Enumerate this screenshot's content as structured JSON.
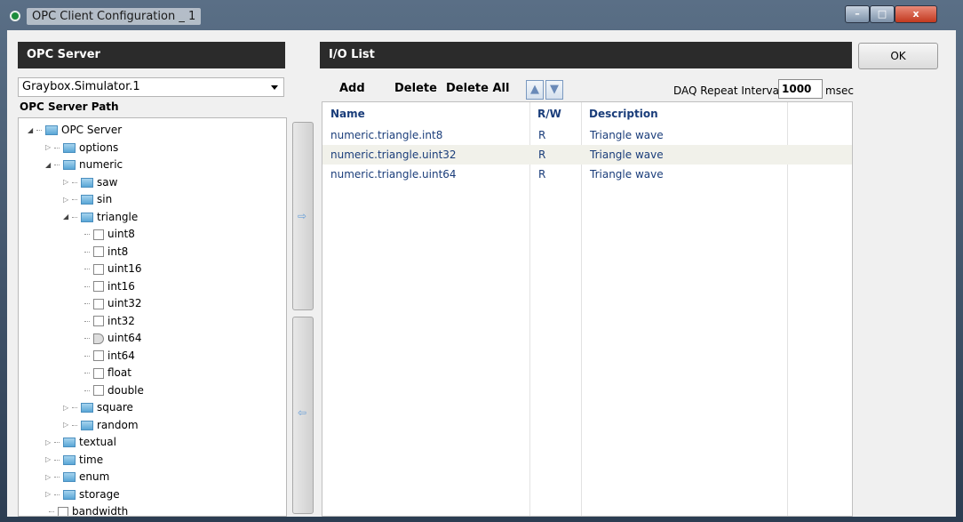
{
  "window": {
    "title": "OPC Client Configuration _ 1",
    "min_label": "–",
    "max_label": "□",
    "close_label": "x"
  },
  "server_panel": {
    "header": "OPC Server",
    "server_combo_value": "Graybox.Simulator.1",
    "path_label": "OPC Server Path",
    "tree": [
      {
        "label": "OPC Server",
        "kind": "folder",
        "expanded": true
      },
      {
        "label": "options",
        "kind": "folder",
        "expanded": false
      },
      {
        "label": "numeric",
        "kind": "folder",
        "expanded": true
      },
      {
        "label": "saw",
        "kind": "folder",
        "expanded": false
      },
      {
        "label": "sin",
        "kind": "folder",
        "expanded": false
      },
      {
        "label": "triangle",
        "kind": "folder",
        "expanded": true
      },
      {
        "label": "uint8",
        "kind": "leaf"
      },
      {
        "label": "int8",
        "kind": "leaf"
      },
      {
        "label": "uint16",
        "kind": "leaf"
      },
      {
        "label": "int16",
        "kind": "leaf"
      },
      {
        "label": "uint32",
        "kind": "leaf"
      },
      {
        "label": "int32",
        "kind": "leaf"
      },
      {
        "label": "uint64",
        "kind": "leaf-tag"
      },
      {
        "label": "int64",
        "kind": "leaf"
      },
      {
        "label": "float",
        "kind": "leaf"
      },
      {
        "label": "double",
        "kind": "leaf"
      },
      {
        "label": "square",
        "kind": "folder",
        "expanded": false
      },
      {
        "label": "random",
        "kind": "folder",
        "expanded": false
      },
      {
        "label": "textual",
        "kind": "folder",
        "expanded": false
      },
      {
        "label": "time",
        "kind": "folder",
        "expanded": false
      },
      {
        "label": "enum",
        "kind": "folder",
        "expanded": false
      },
      {
        "label": "storage",
        "kind": "folder",
        "expanded": false
      },
      {
        "label": "bandwidth",
        "kind": "leaf"
      }
    ]
  },
  "io_panel": {
    "header": "I/O List",
    "add_label": "Add",
    "delete_label": "Delete",
    "delete_all_label": "Delete All",
    "up_label": "▲",
    "down_label": "▼",
    "daq_label": "DAQ Repeat Interval",
    "daq_value": "1000",
    "daq_unit": "msec",
    "columns": [
      "Name",
      "R/W",
      "Description"
    ],
    "rows": [
      {
        "name": "numeric.triangle.int8",
        "rw": "R",
        "description": "Triangle wave"
      },
      {
        "name": "numeric.triangle.uint32",
        "rw": "R",
        "description": "Triangle wave"
      },
      {
        "name": "numeric.triangle.uint64",
        "rw": "R",
        "description": "Triangle wave"
      }
    ]
  },
  "move_buttons": {
    "add_arrow": "⇨",
    "remove_arrow": "⇦"
  },
  "ok_label": "OK"
}
